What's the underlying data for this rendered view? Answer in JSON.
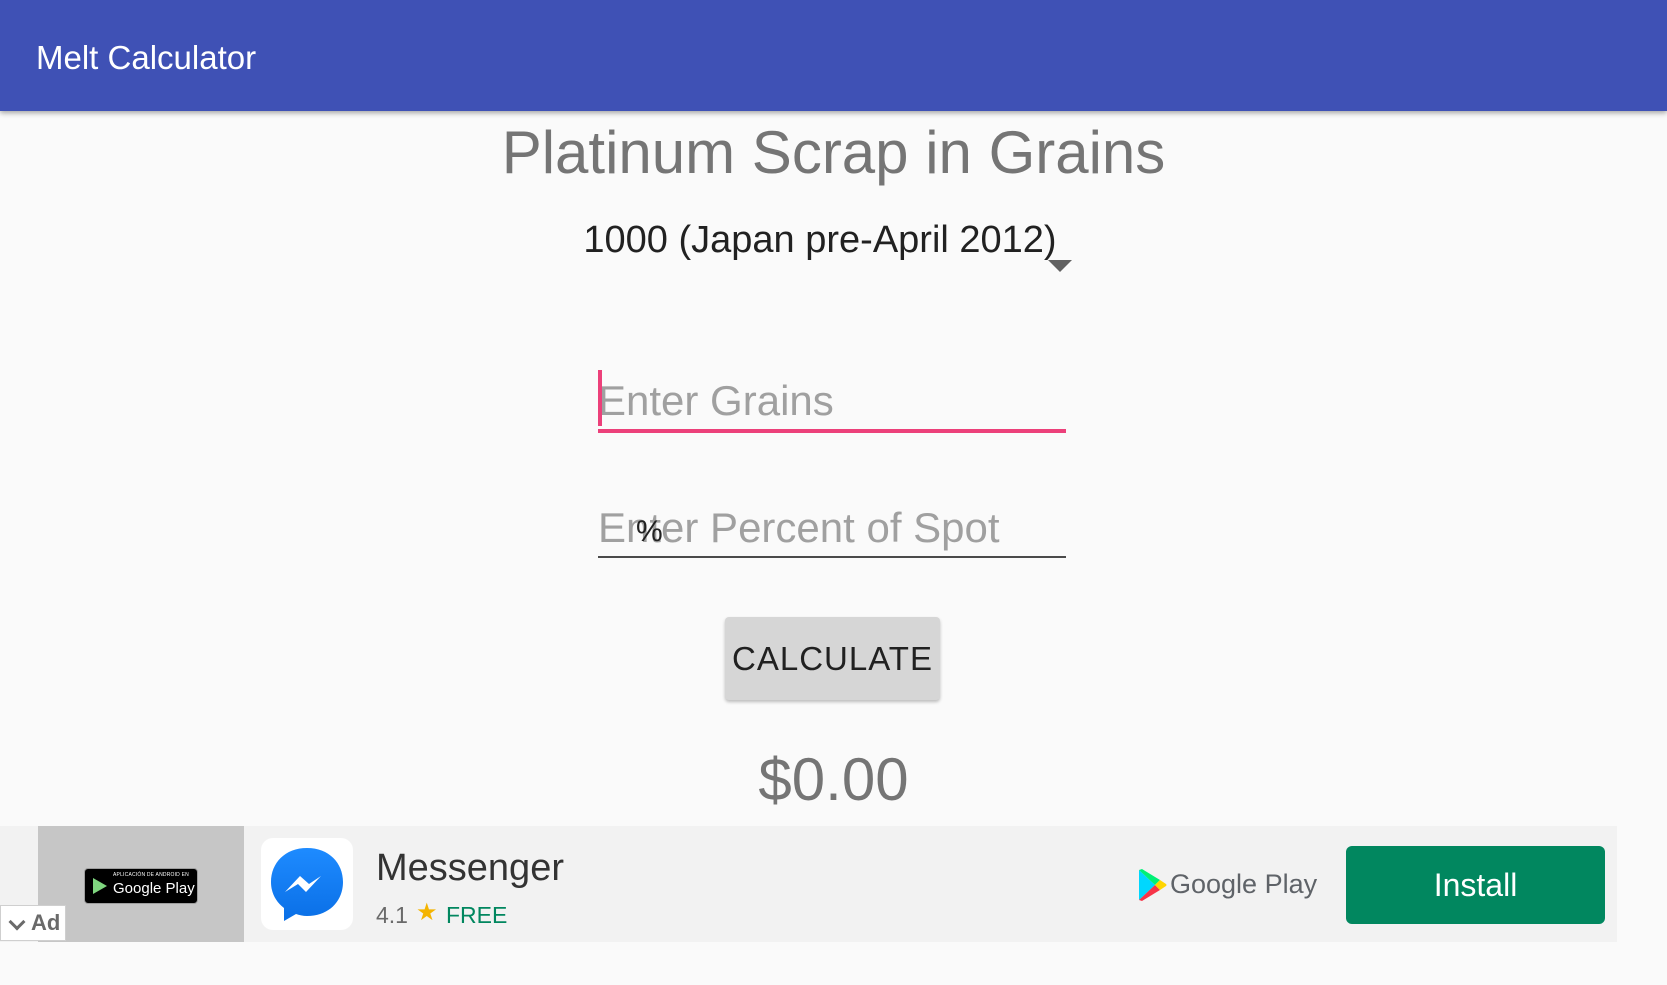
{
  "appbar": {
    "title": "Melt Calculator"
  },
  "main": {
    "heading": "Platinum Scrap in Grains",
    "spinner": {
      "selected": "1000 (Japan pre-April 2012)"
    },
    "grains_field": {
      "value": "",
      "placeholder": "Enter Grains"
    },
    "percent_field": {
      "value": "",
      "placeholder": "Enter Percent of Spot",
      "suffix": "%"
    },
    "calculate_button": "CALCULATE",
    "result": "$0.00"
  },
  "ad": {
    "label": "Ad",
    "badge_small": "APLICACIÓN DE ANDROID EN",
    "badge_big": "Google Play",
    "app_name": "Messenger",
    "rating": "4.1",
    "star": "★",
    "price": "FREE",
    "store_name": "Google Play",
    "install_button": "Install",
    "colors": {
      "install": "#01875f",
      "rating_star": "#f4b400"
    }
  },
  "colors": {
    "appbar": "#3f51b5",
    "accent": "#ec407a",
    "background": "#fafafa"
  }
}
